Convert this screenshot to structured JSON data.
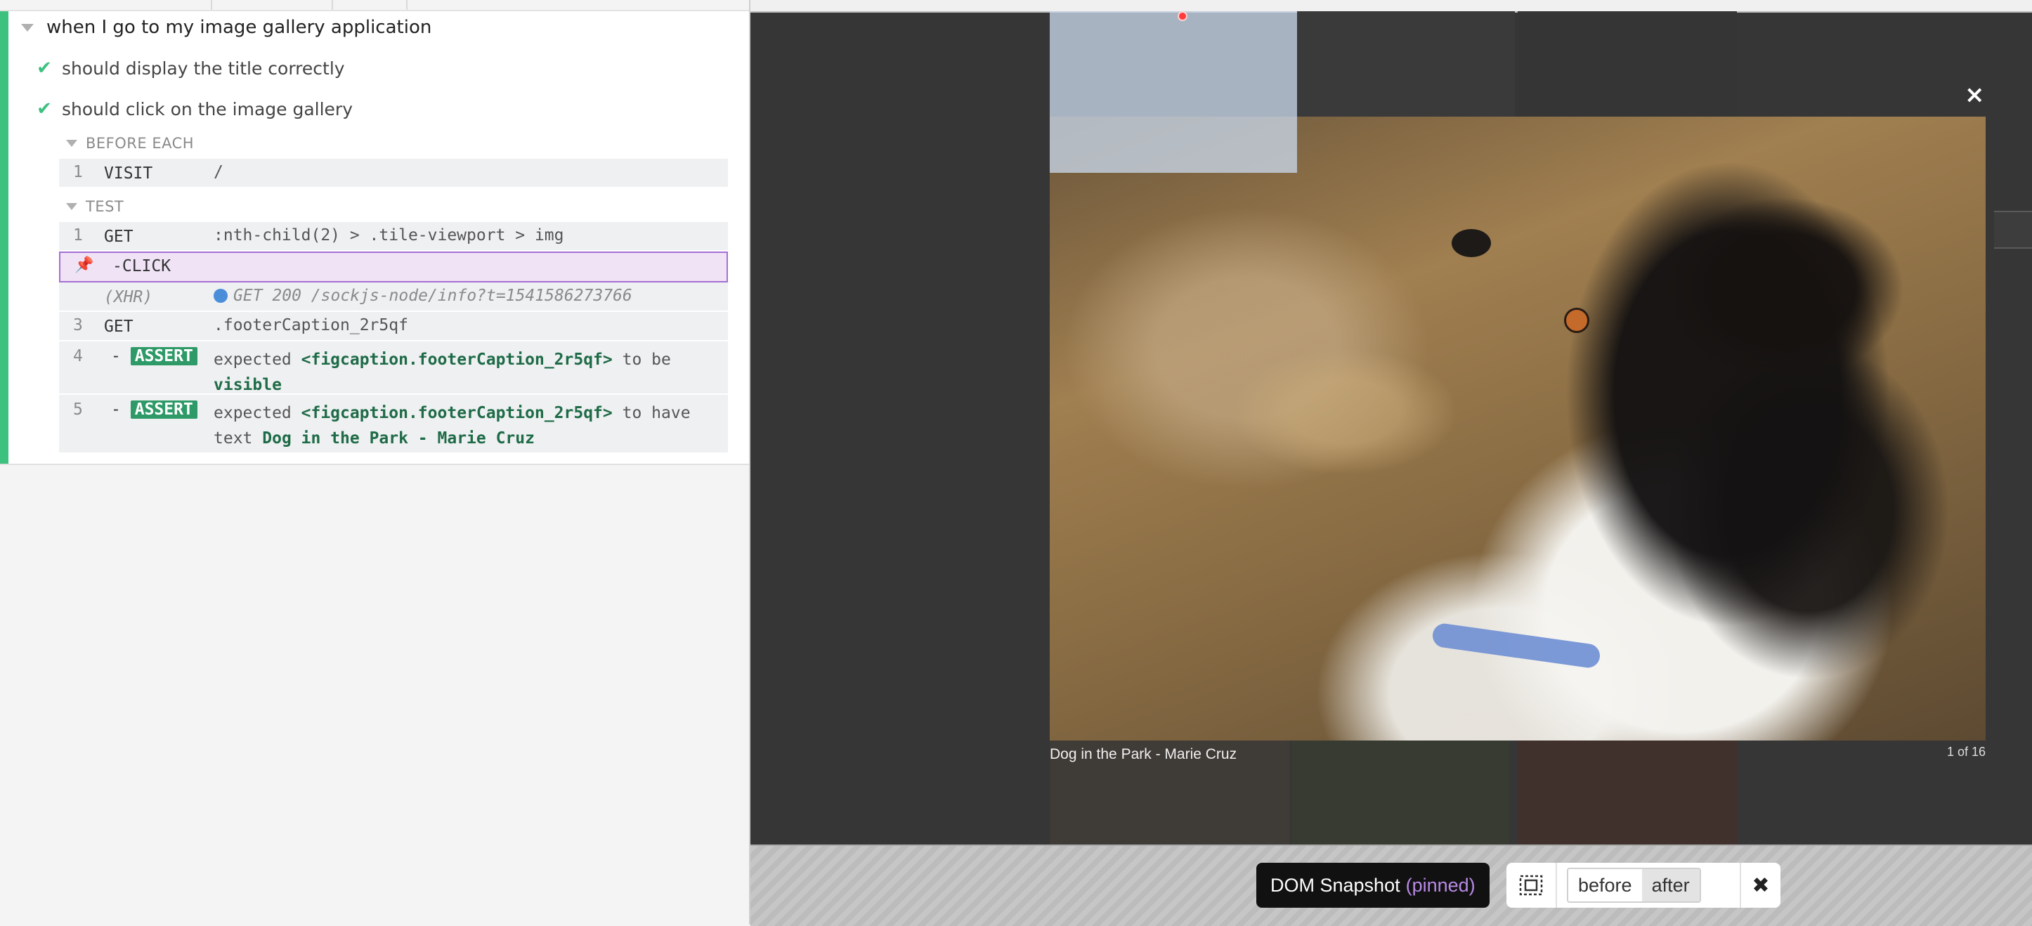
{
  "reporter": {
    "suite_title": "when I go to my image gallery application",
    "tests": [
      {
        "label": "should display the title correctly",
        "status": "passed"
      },
      {
        "label": "should click on the image gallery",
        "status": "passed"
      }
    ],
    "hooks": {
      "before_each": {
        "title": "BEFORE EACH",
        "commands": [
          {
            "num": "1",
            "name": "VISIT",
            "message": "/"
          }
        ]
      },
      "test": {
        "title": "TEST",
        "commands": [
          {
            "num": "1",
            "name": "GET",
            "message": ":nth-child(2) > .tile-viewport > img"
          },
          {
            "num": "",
            "name": "-CLICK",
            "message": "",
            "pinned": true
          },
          {
            "num": "",
            "name": "(XHR)",
            "message": "GET 200 /sockjs-node/info?t=1541586273766",
            "type": "xhr"
          },
          {
            "num": "3",
            "name": "GET",
            "message": ".footerCaption_2r5qf"
          },
          {
            "num": "4",
            "name": "-",
            "badge": "ASSERT",
            "expected_label": "expected",
            "subject": "<figcaption.footerCaption_2r5qf>",
            "predicate": "to be",
            "predicate_cont": "visible"
          },
          {
            "num": "5",
            "name": "-",
            "badge": "ASSERT",
            "expected_label": "expected",
            "subject": "<figcaption.footerCaption_2r5qf>",
            "predicate": "to have",
            "predicate_cont": "text",
            "value": "Dog in the Park - Marie Cruz"
          }
        ]
      }
    }
  },
  "preview": {
    "caption": "Dog in the Park - Marie Cruz",
    "counter": "1 of 16",
    "close_label": "×"
  },
  "snapshot": {
    "label": "DOM Snapshot",
    "pinned_label": "(pinned)",
    "before_label": "before",
    "after_label": "after",
    "selected": "after",
    "close_label": "✖"
  },
  "colors": {
    "pass": "#3cc17f",
    "assert": "#2e9a67",
    "pinned_border": "#a46fd4",
    "pinned_bg": "#efe3f5",
    "xhr_dot": "#4a8dd9",
    "preview_bg": "#363636"
  }
}
